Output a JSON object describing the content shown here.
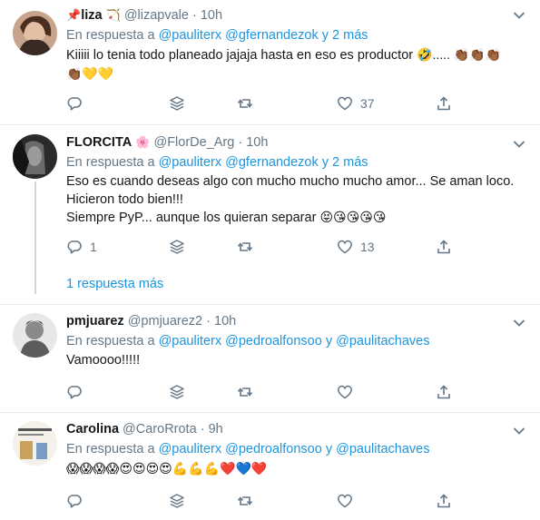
{
  "tweets": [
    {
      "name": "liza",
      "name_prefix_emoji": "📌",
      "name_suffix_emoji": "🏹",
      "handle": "@lizapvale",
      "time": "10h",
      "reply_prefix": "En respuesta a",
      "reply_m1": "@pauliterx",
      "reply_m2": "@gfernandezok",
      "reply_rest": "y 2 más",
      "line1": "Kiiiii lo tenia todo planeado jajaja hasta en eso es productor",
      "line1_emoji": "🤣..... 👏🏾👏🏾👏🏾",
      "line2_emoji": "👏🏾💛💛",
      "likes": "37"
    },
    {
      "name": "FLORCITA",
      "name_suffix_emoji": "🌸",
      "handle": "@FlorDe_Arg",
      "time": "10h",
      "reply_prefix": "En respuesta a",
      "reply_m1": "@pauliterx",
      "reply_m2": "@gfernandezok",
      "reply_rest": "y 2 más",
      "line1": "Eso es cuando deseas algo con mucho mucho mucho amor... Se aman loco.",
      "line2": "Hicieron todo bien!!!",
      "line3": "Siempre PyP... aunque los quieran separar",
      "line3_emoji": "😝😘😘😘😘",
      "replies": "1",
      "likes": "13",
      "more_replies": "1 respuesta más"
    },
    {
      "name": "pmjuarez",
      "handle": "@pmjuarez2",
      "time": "10h",
      "reply_prefix": "En respuesta a",
      "reply_m1": "@pauliterx",
      "reply_m2": "@pedroalfonsoo",
      "reply_and": "y",
      "reply_m3": "@paulitachaves",
      "line1": "Vamoooo!!!!!"
    },
    {
      "name": "Carolina",
      "handle": "@CaroRrota",
      "time": "9h",
      "reply_prefix": "En respuesta a",
      "reply_m1": "@pauliterx",
      "reply_m2": "@pedroalfonsoo",
      "reply_and": "y",
      "reply_m3": "@paulitachaves",
      "line1_emoji": "😱😱😱😱😍😍😍😍💪💪💪❤️💙❤️"
    }
  ],
  "common": {
    "dot": "·"
  }
}
